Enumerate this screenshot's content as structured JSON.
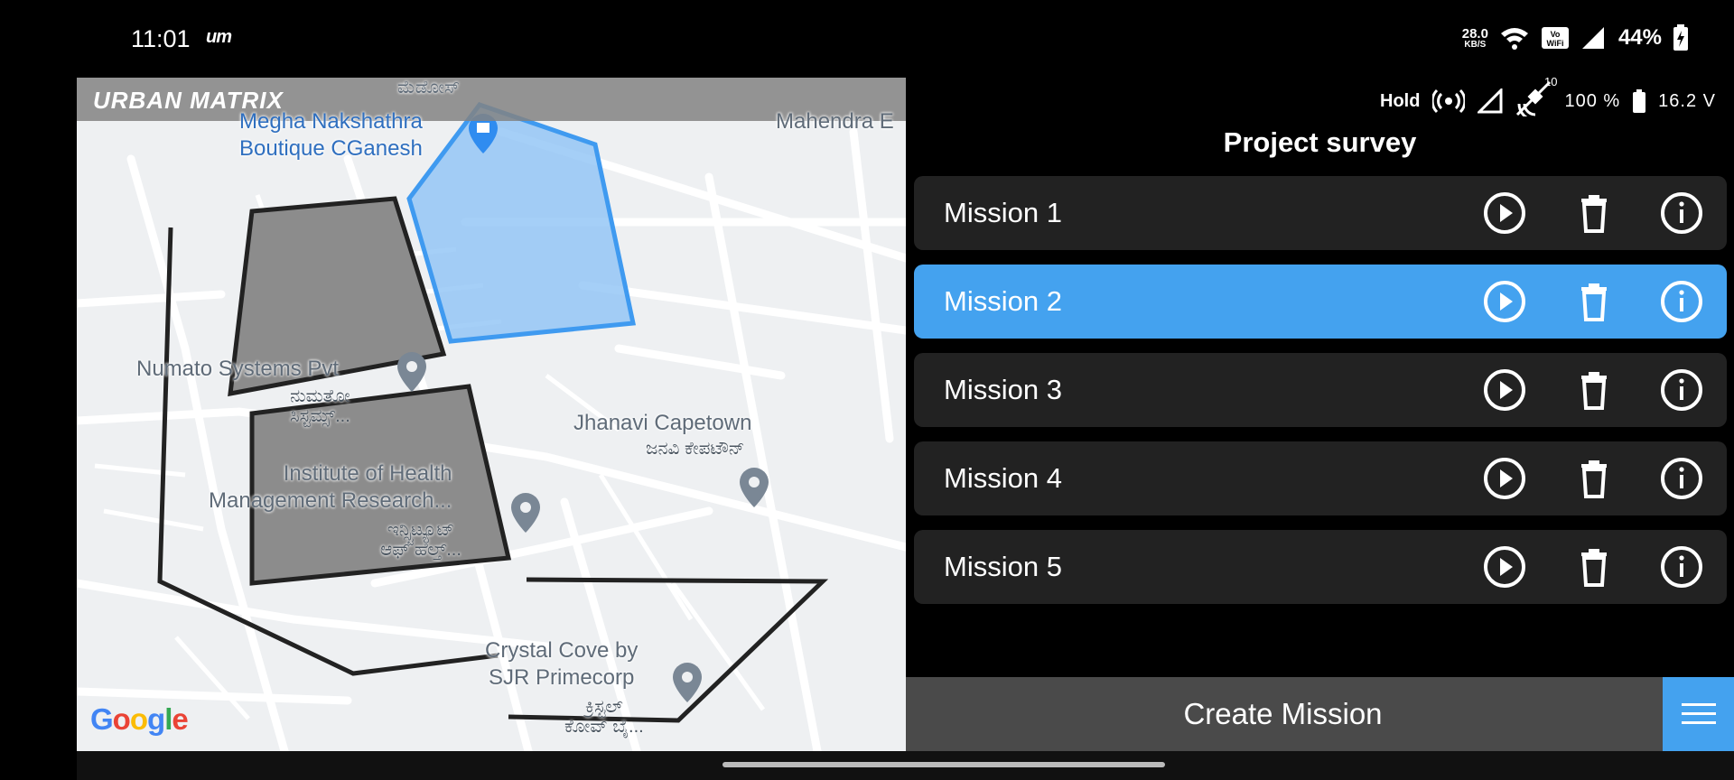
{
  "status_bar": {
    "time": "11:01",
    "carrier_logo": "um",
    "net_speed_value": "28.0",
    "net_speed_unit": "KB/S",
    "battery_percent": "44%",
    "icons": [
      "wifi-icon",
      "vowifi-icon",
      "cell-signal-icon",
      "battery-charging-icon"
    ]
  },
  "map": {
    "brand": "URBAN MATRIX",
    "top_cut_label": "ಮೆಡೋಸ್",
    "pois": [
      {
        "name": "Megha Nakshathra\nBoutique CGanesh",
        "sub": ""
      },
      {
        "name": "Mahendra E",
        "sub": ""
      },
      {
        "name": "Numato Systems Pvt",
        "sub": "ನುಮತೋ\nಸಿಸ್ಟಮ್ಸ್..."
      },
      {
        "name": "Jhanavi Capetown",
        "sub": "ಜನವಿ ಕೇಪಟೌನ್"
      },
      {
        "name": "Institute of Health\nManagement Research...",
        "sub": "ಇನ್ಸ್ಟಿಟ್ಯೂಟ್\nಆಫ್ ಹೆಲ್ತ್..."
      },
      {
        "name": "Crystal Cove by\nSJR Primecorp",
        "sub": "ಕ್ರಿಸ್ಟಲ್\nಕೋವ್ ಬೈ..."
      }
    ],
    "attribution": "Google",
    "colors": {
      "active_polygon": "#8ec3f5",
      "active_stroke": "#3f9af0",
      "inactive_polygon": "#8c8c8c"
    }
  },
  "telemetry": {
    "mode": "Hold",
    "satellite_count": "10",
    "battery_percent": "100 %",
    "voltage": "16.2 V"
  },
  "panel": {
    "title": "Project survey",
    "missions": [
      {
        "name": "Mission 1",
        "active": false
      },
      {
        "name": "Mission 2",
        "active": true
      },
      {
        "name": "Mission 3",
        "active": false
      },
      {
        "name": "Mission 4",
        "active": false
      },
      {
        "name": "Mission 5",
        "active": false
      }
    ],
    "create_label": "Create Mission",
    "accent": "#44a2ef"
  }
}
